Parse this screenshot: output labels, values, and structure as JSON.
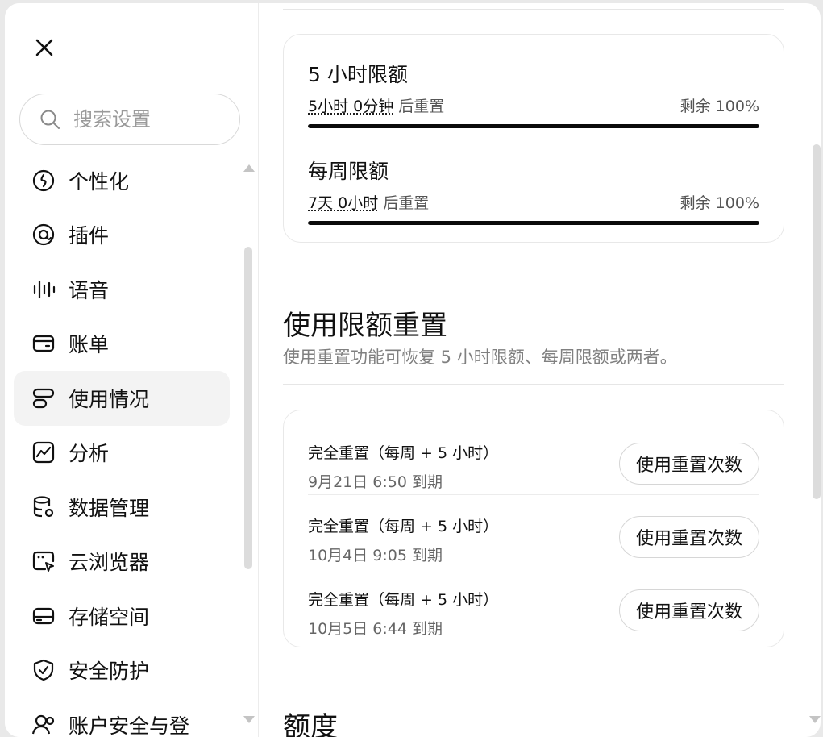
{
  "sidebar": {
    "search_placeholder": "搜索设置",
    "items": [
      {
        "label": "个性化",
        "icon": "personalize-icon"
      },
      {
        "label": "插件",
        "icon": "plugin-icon"
      },
      {
        "label": "语音",
        "icon": "voice-waveform-icon"
      },
      {
        "label": "账单",
        "icon": "billing-card-icon"
      },
      {
        "label": "使用情况",
        "icon": "usage-icon",
        "active": true
      },
      {
        "label": "分析",
        "icon": "analytics-chart-icon"
      },
      {
        "label": "数据管理",
        "icon": "database-gear-icon"
      },
      {
        "label": "云浏览器",
        "icon": "cloud-browser-icon"
      },
      {
        "label": "存储空间",
        "icon": "storage-drive-icon"
      },
      {
        "label": "安全防护",
        "icon": "shield-check-icon"
      },
      {
        "label": "账户安全与登",
        "icon": "account-security-icon"
      }
    ]
  },
  "quotas": [
    {
      "title": "5 小时限额",
      "time": "5小时 0分钟",
      "suffix": "后重置",
      "remaining": "剩余 100%",
      "fill": 1.0
    },
    {
      "title": "每周限额",
      "time": "7天 0小时",
      "suffix": "后重置",
      "remaining": "剩余 100%",
      "fill": 1.0
    }
  ],
  "reset_section": {
    "title": "使用限额重置",
    "description": "使用重置功能可恢复 5 小时限额、每周限额或两者。",
    "items": [
      {
        "title": "完全重置（每周 + 5 小时）",
        "expiry": "9月21日 6:50 到期",
        "button": "使用重置次数"
      },
      {
        "title": "完全重置（每周 + 5 小时）",
        "expiry": "10月4日 9:05 到期",
        "button": "使用重置次数"
      },
      {
        "title": "完全重置（每周 + 5 小时）",
        "expiry": "10月5日 6:44 到期",
        "button": "使用重置次数"
      }
    ]
  },
  "next_section": {
    "title": "额度"
  }
}
